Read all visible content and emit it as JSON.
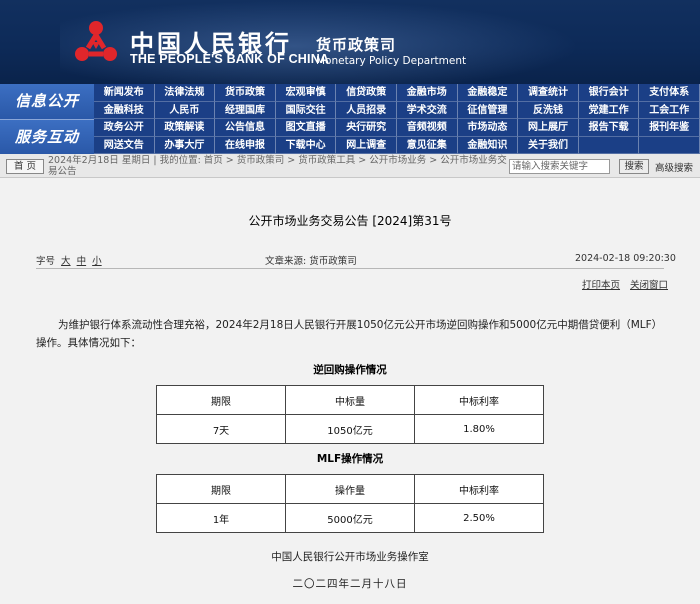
{
  "header": {
    "bank_name_cn": "中国人民银行",
    "bank_name_en": "THE PEOPLE'S BANK OF CHINA",
    "dept_cn": "货币政策司",
    "dept_en": "Monetary Policy Department"
  },
  "nav": {
    "section1": "信息公开",
    "section2": "服务互动",
    "items": [
      "新闻发布",
      "法律法规",
      "货币政策",
      "宏观审慎",
      "信贷政策",
      "金融市场",
      "金融稳定",
      "调查统计",
      "银行会计",
      "支付体系",
      "金融科技",
      "人民币",
      "经理国库",
      "国际交往",
      "人员招录",
      "学术交流",
      "征信管理",
      "反洗钱",
      "党建工作",
      "工会工作",
      "政务公开",
      "政策解读",
      "公告信息",
      "图文直播",
      "央行研究",
      "音频视频",
      "市场动态",
      "网上展厅",
      "报告下载",
      "报刊年鉴",
      "网送文告",
      "办事大厅",
      "在线申报",
      "下载中心",
      "网上调查",
      "意见征集",
      "金融知识",
      "关于我们",
      "",
      ""
    ]
  },
  "breadcrumb": {
    "home": "首 页",
    "path": "2024年2月18日 星期日 | 我的位置: 首页 > 货币政策司 > 货币政策工具 > 公开市场业务 > 公开市场业务交易公告",
    "search_placeholder": "请输入搜索关键字",
    "search_button": "搜索",
    "advanced": "高级搜索"
  },
  "article": {
    "title": "公开市场业务交易公告 [2024]第31号",
    "font_size_label": "字号",
    "size_large": "大",
    "size_medium": "中",
    "size_small": "小",
    "source": "文章来源: 货币政策司",
    "datetime": "2024-02-18 09:20:30",
    "print": "打印本页",
    "close": "关闭窗口",
    "intro": "为维护银行体系流动性合理充裕，2024年2月18日人民银行开展1050亿元公开市场逆回购操作和5000亿元中期借贷便利（MLF）操作。具体情况如下：",
    "table1_title": "逆回购操作情况",
    "table1": {
      "headers": [
        "期限",
        "中标量",
        "中标利率"
      ],
      "row": [
        "7天",
        "1050亿元",
        "1.80%"
      ]
    },
    "table2_title": "MLF操作情况",
    "table2": {
      "headers": [
        "期限",
        "操作量",
        "中标利率"
      ],
      "row": [
        "1年",
        "5000亿元",
        "2.50%"
      ]
    },
    "signature": "中国人民银行公开市场业务操作室",
    "date_cn": "二〇二四年二月十八日"
  }
}
